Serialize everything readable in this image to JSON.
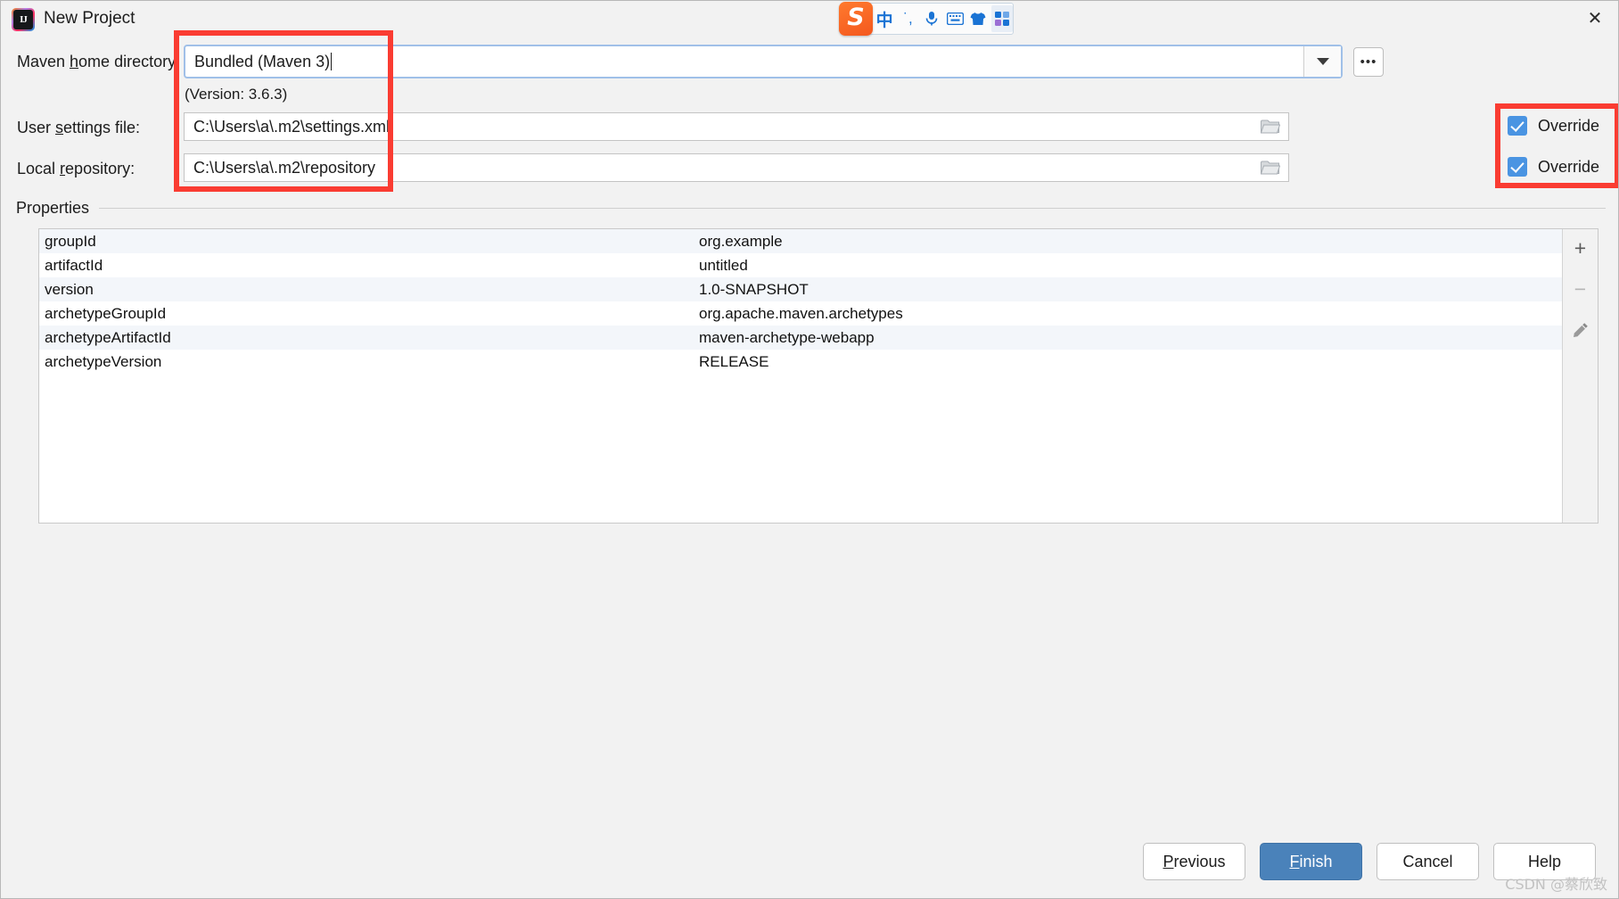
{
  "window": {
    "title": "New Project",
    "logo_icon": "intellij-idea-icon",
    "logo_text": "IJ",
    "close_icon": "✕"
  },
  "ime_toolbar": {
    "logo": "S",
    "items": [
      {
        "name": "language-mode",
        "glyph": "中"
      },
      {
        "name": "punctuation-mode",
        "glyph": "˙,"
      },
      {
        "name": "voice-input",
        "glyph": "🎙"
      },
      {
        "name": "soft-keyboard",
        "glyph": "⌨"
      },
      {
        "name": "skin",
        "glyph": "👕"
      },
      {
        "name": "toolbox",
        "glyph": "░"
      }
    ]
  },
  "form": {
    "maven_home": {
      "label_pre": "Maven ",
      "label_key": "h",
      "label_post": "ome directory:",
      "value": "Bundled (Maven 3)",
      "version_text": "(Version: 3.6.3)",
      "browse_label": "•••"
    },
    "user_settings": {
      "label_pre": "User ",
      "label_key": "s",
      "label_post": "ettings file:",
      "value": "C:\\Users\\a\\.m2\\settings.xml",
      "override_label": "Override",
      "override_checked": true
    },
    "local_repository": {
      "label_pre": "Local ",
      "label_key": "r",
      "label_post": "epository:",
      "value": "C:\\Users\\a\\.m2\\repository",
      "override_label": "Override",
      "override_checked": true
    }
  },
  "properties": {
    "section_title": "Properties",
    "rows": [
      {
        "key": "groupId",
        "value": "org.example"
      },
      {
        "key": "artifactId",
        "value": "untitled"
      },
      {
        "key": "version",
        "value": "1.0-SNAPSHOT"
      },
      {
        "key": "archetypeGroupId",
        "value": "org.apache.maven.archetypes"
      },
      {
        "key": "archetypeArtifactId",
        "value": "maven-archetype-webapp"
      },
      {
        "key": "archetypeVersion",
        "value": "RELEASE"
      }
    ],
    "toolbar": {
      "add": "+",
      "remove": "−",
      "edit": "✎"
    }
  },
  "buttons": {
    "previous": {
      "pre": "",
      "key": "P",
      "post": "revious"
    },
    "finish": {
      "pre": "",
      "key": "F",
      "post": "inish"
    },
    "cancel": {
      "pre": "Cancel",
      "key": "",
      "post": ""
    },
    "help": {
      "pre": "Help",
      "key": "",
      "post": ""
    }
  },
  "watermark": "CSDN @蔡欣致",
  "colors": {
    "accent_blue": "#4a82ba",
    "checkbox_blue": "#4a94e2",
    "annotation_red": "#fa3c32",
    "focus_ring": "#a0c0e8",
    "row_alt": "#f3f6fa"
  }
}
